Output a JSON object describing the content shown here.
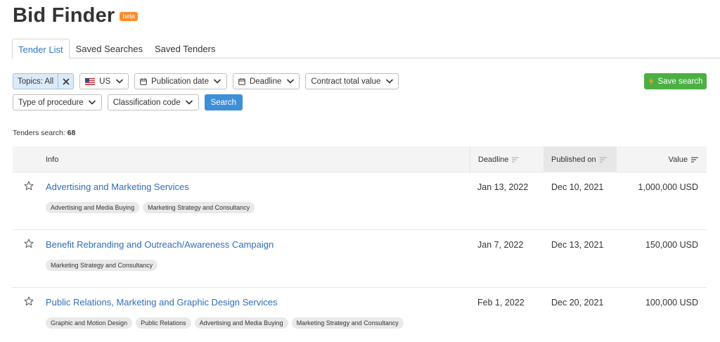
{
  "header": {
    "title": "Bid Finder",
    "badge": "beta"
  },
  "tabs": [
    {
      "label": "Tender List",
      "active": true
    },
    {
      "label": "Saved Searches",
      "active": false
    },
    {
      "label": "Saved Tenders",
      "active": false
    }
  ],
  "filters": {
    "topics": "Topics: All",
    "country": "US",
    "publication_date": "Publication date",
    "deadline": "Deadline",
    "contract_value": "Contract total value",
    "procedure": "Type of procedure",
    "classification": "Classification code",
    "search_label": "Search",
    "save_search_label": "Save search"
  },
  "results": {
    "label": "Tenders search:",
    "count": "68"
  },
  "table": {
    "columns": {
      "info": "Info",
      "deadline": "Deadline",
      "published": "Published on",
      "value": "Value"
    },
    "rows": [
      {
        "name": "Advertising and Marketing Services",
        "tags": [
          "Advertising and Media Buying",
          "Marketing Strategy and Consultancy"
        ],
        "deadline": "Jan 13, 2022",
        "published": "Dec 10, 2021",
        "value": "1,000,000 USD"
      },
      {
        "name": "Benefit Rebranding and Outreach/Awareness Campaign",
        "tags": [
          "Marketing Strategy and Consultancy"
        ],
        "deadline": "Jan 7, 2022",
        "published": "Dec 13, 2021",
        "value": "150,000 USD"
      },
      {
        "name": "Public Relations, Marketing and Graphic Design Services",
        "tags": [
          "Graphic and Motion Design",
          "Public Relations",
          "Advertising and Media Buying",
          "Marketing Strategy and Consultancy"
        ],
        "deadline": "Feb 1, 2022",
        "published": "Dec 20, 2021",
        "value": "100,000 USD"
      }
    ]
  },
  "colors": {
    "link": "#2f6fb8",
    "accent": "#3e8ed8",
    "save": "#4caf44",
    "badge": "#ff8c2b"
  },
  "icons": [
    "us-flag-icon",
    "calendar-icon",
    "chevron-down-icon",
    "close-icon",
    "bolt-icon",
    "sort-icon",
    "star-icon"
  ]
}
